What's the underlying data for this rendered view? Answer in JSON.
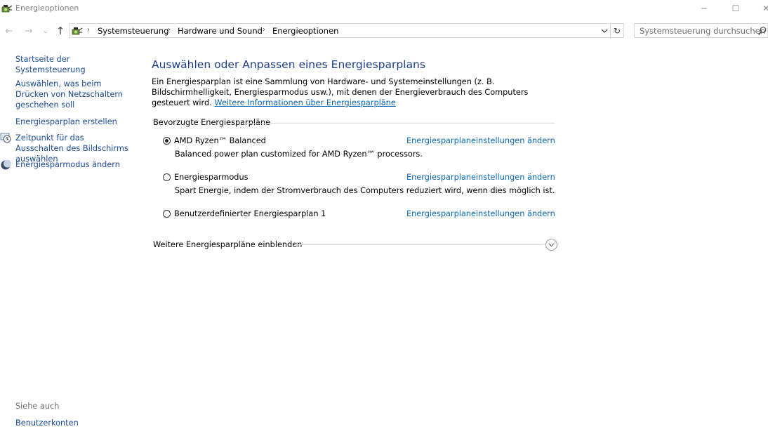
{
  "window": {
    "title": "Energieoptionen",
    "icon": "power-options-icon",
    "controls": {
      "minimize": "─",
      "maximize": "☐",
      "close": "✕"
    }
  },
  "nav": {
    "back_glyph": "←",
    "forward_glyph": "→",
    "recent_glyph": "⌄",
    "up_glyph": "↑",
    "breadcrumb": [
      "Systemsteuerung",
      "Hardware und Sound",
      "Energieoptionen"
    ],
    "separator": "›",
    "refresh_glyph": "↻",
    "search_placeholder": "Systemsteuerung durchsuchen"
  },
  "sidebar": {
    "items": [
      {
        "label": "Startseite der Systemsteuerung",
        "icon": ""
      },
      {
        "label": "Auswählen, was beim Drücken von Netzschaltern geschehen soll",
        "icon": ""
      },
      {
        "label": "Energiesparplan erstellen",
        "icon": ""
      },
      {
        "label": "Zeitpunkt für das Ausschalten des Bildschirms auswählen",
        "icon": "display-clock-icon"
      },
      {
        "label": "Energiesparmodus ändern",
        "icon": "moon-icon"
      }
    ],
    "see_also_label": "Siehe auch",
    "see_also": [
      "Benutzerkonten"
    ]
  },
  "main": {
    "title": "Auswählen oder Anpassen eines Energiesparplans",
    "description": "Ein Energiesparplan ist eine Sammlung von Hardware- und Systemeinstellungen (z. B. Bildschirmhelligkeit, Energiesparmodus usw.), mit denen der Energieverbrauch des Computers gesteuert wird.",
    "description_link": "Weitere Informationen über Energiesparpläne",
    "preferred_label": "Bevorzugte Energiesparpläne",
    "plans": [
      {
        "name": "AMD Ryzen™ Balanced",
        "description": "Balanced power plan customized for AMD Ryzen™ processors.",
        "selected": true,
        "link": "Energiesparplaneinstellungen ändern"
      },
      {
        "name": "Energiesparmodus",
        "description": "Spart Energie, indem der Stromverbrauch des Computers reduziert wird, wenn dies möglich ist.",
        "selected": false,
        "link": "Energiesparplaneinstellungen ändern"
      },
      {
        "name": "Benutzerdefinierter Energiesparplan 1",
        "description": "",
        "selected": false,
        "link": "Energiesparplaneinstellungen ändern"
      }
    ],
    "more_plans_label": "Weitere Energiesparpläne einblenden"
  },
  "colors": {
    "link": "#0a66b7",
    "title": "#1e3e8c",
    "sidebar_link": "#1a4b9a"
  }
}
